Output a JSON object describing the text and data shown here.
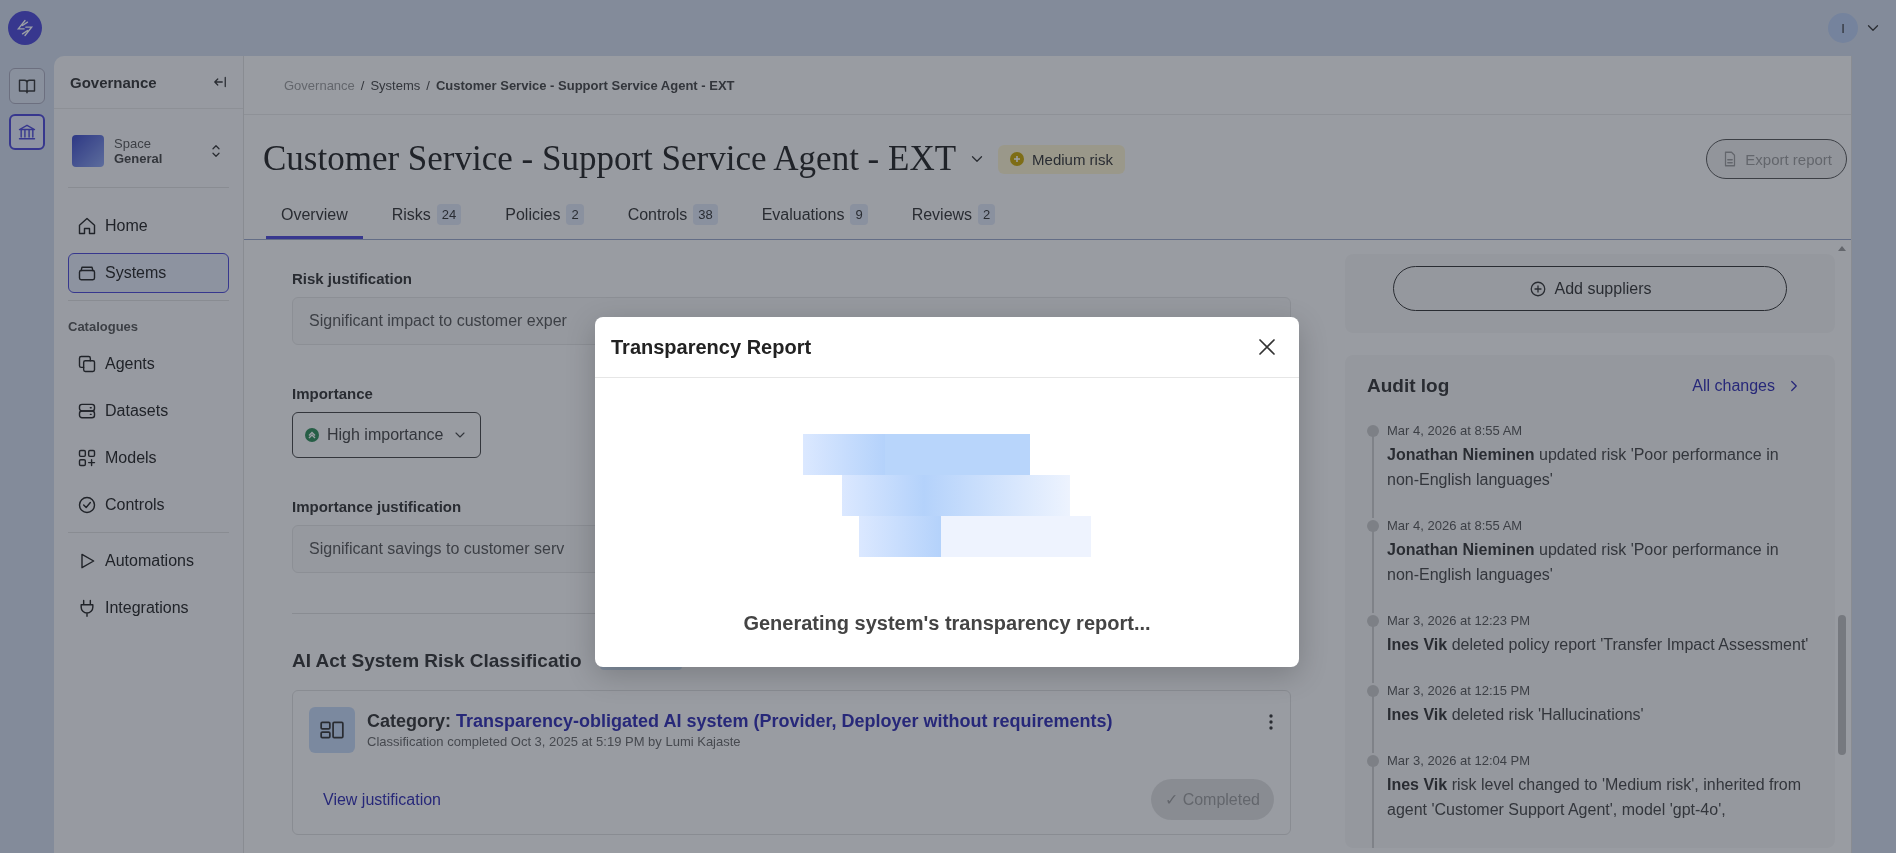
{
  "top_bar": {
    "avatar": "I"
  },
  "rail": [
    {
      "selected": false
    },
    {
      "selected": true
    }
  ],
  "sidebar": {
    "title": "Governance",
    "space": {
      "label": "Space",
      "name": "General"
    },
    "items": [
      {
        "label": "Home",
        "selected": false
      },
      {
        "label": "Systems",
        "selected": true
      }
    ],
    "section": "Catalogues",
    "catalogue_items": [
      {
        "label": "Agents",
        "selected": false
      },
      {
        "label": "Datasets",
        "selected": false
      },
      {
        "label": "Models",
        "selected": false
      },
      {
        "label": "Controls",
        "selected": false
      }
    ],
    "bottom_items": [
      {
        "label": "Automations",
        "selected": false
      },
      {
        "label": "Integrations",
        "selected": false
      }
    ]
  },
  "breadcrumb": [
    {
      "kind": "link",
      "text": "Governance"
    },
    {
      "kind": "separator",
      "text": "/"
    },
    {
      "kind": "link",
      "text": "Systems"
    },
    {
      "kind": "separator",
      "text": "/"
    },
    {
      "kind": "current",
      "text": "Customer Service - Support Service Agent - EXT"
    }
  ],
  "header": {
    "title": "Customer Service - Support Service Agent - EXT",
    "risk_badge": "Medium risk",
    "export_button": "Export report"
  },
  "tabs": [
    {
      "label": "Overview",
      "selected": true
    },
    {
      "label": "Risks",
      "count": "24",
      "selected": false
    },
    {
      "label": "Policies",
      "count": "2",
      "selected": false
    },
    {
      "label": "Controls",
      "count": "38",
      "selected": false
    },
    {
      "label": "Evaluations",
      "count": "9",
      "selected": false
    },
    {
      "label": "Reviews",
      "count": "2",
      "selected": false
    }
  ],
  "overview": {
    "risk_justification": {
      "label": "Risk justification",
      "value": "Significant impact to customer exper"
    },
    "importance": {
      "label": "Importance",
      "value": "High importance"
    },
    "importance_justification": {
      "label": "Importance justification",
      "value": "Significant savings to customer serv"
    },
    "classification": {
      "heading": "AI Act System Risk Classificatio",
      "category_label": "Category:",
      "category": "Transparency-obligated AI system (Provider, Deployer without requirements)",
      "meta": "Classification completed Oct 3, 2025 at 5:19 PM by Lumi Kajaste",
      "link": "View justification",
      "status_icon": "✓",
      "status": "Completed"
    }
  },
  "suppliers": {
    "button": "Add suppliers"
  },
  "audit_log": {
    "title": "Audit log",
    "link": "All changes",
    "entries": [
      {
        "date": "Mar 4, 2026 at 8:55 AM",
        "text": "**Jonathan Nieminen** updated risk 'Poor performance in non-English languages'"
      },
      {
        "date": "Mar 4, 2026 at 8:55 AM",
        "text": "**Jonathan Nieminen** updated risk 'Poor performance in non-English languages'"
      },
      {
        "date": "Mar 3, 2026 at 12:23 PM",
        "text": "**Ines Vik** deleted policy report 'Transfer Impact Assessment'"
      },
      {
        "date": "Mar 3, 2026 at 12:15 PM",
        "text": "**Ines Vik** deleted risk 'Hallucinations'"
      },
      {
        "date": "Mar 3, 2026 at 12:04 PM",
        "text": "**Ines Vik** risk level changed to 'Medium risk', inherited from agent 'Customer Support Agent', model 'gpt-4o',"
      }
    ]
  },
  "modal": {
    "title": "Transparency Report",
    "message": "Generating system's transparency report..."
  }
}
